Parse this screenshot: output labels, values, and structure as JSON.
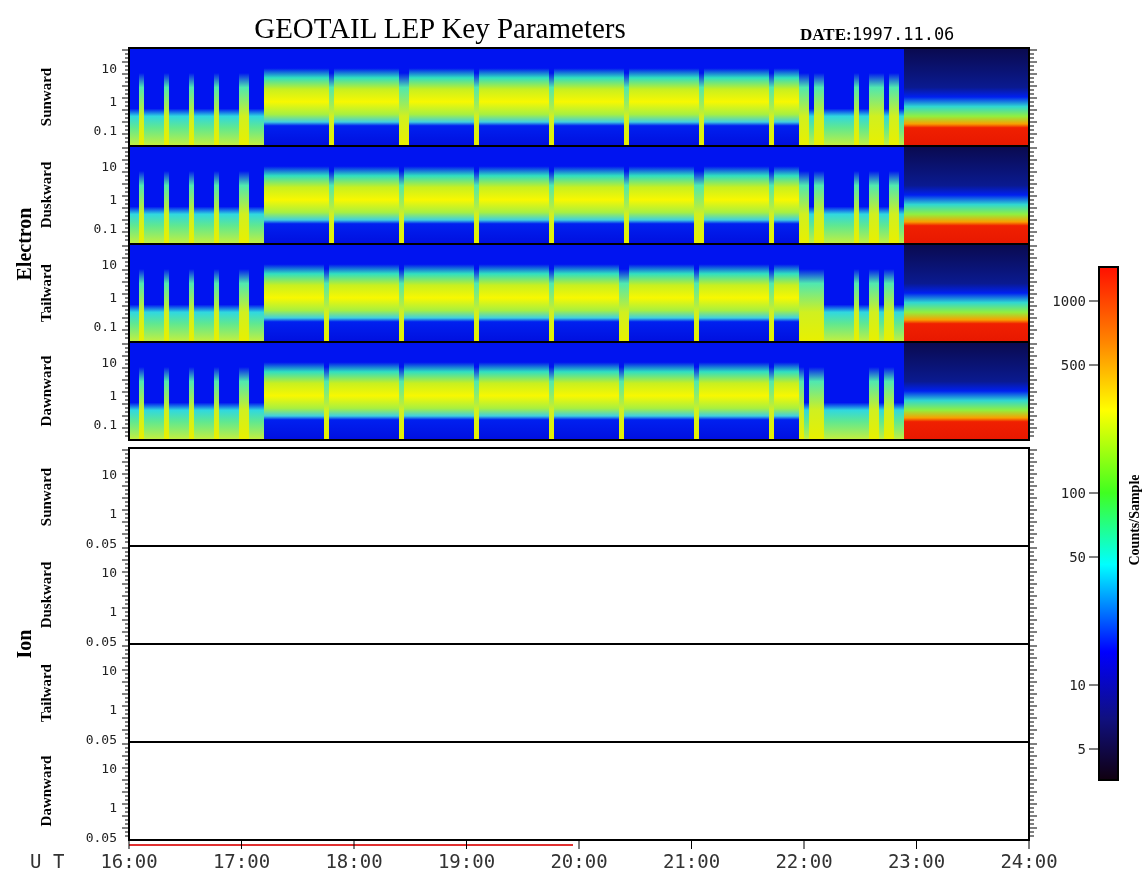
{
  "title": "GEOTAIL LEP Key Parameters",
  "date": {
    "label": "DATE:",
    "value": "1997.11.06"
  },
  "groups": [
    {
      "label": "Electron",
      "kind": "spectrogram",
      "panels": [
        {
          "label": "Sunward",
          "yticks": [
            "10",
            "1",
            "0.1"
          ]
        },
        {
          "label": "Duskward",
          "yticks": [
            "10",
            "1",
            "0.1"
          ]
        },
        {
          "label": "Tailward",
          "yticks": [
            "10",
            "1",
            "0.1"
          ]
        },
        {
          "label": "Dawnward",
          "yticks": [
            "10",
            "1",
            "0.1"
          ]
        }
      ]
    },
    {
      "label": "Ion",
      "kind": "empty",
      "panels": [
        {
          "label": "Sunward",
          "yticks": [
            "10",
            "1",
            "0.05"
          ]
        },
        {
          "label": "Duskward",
          "yticks": [
            "10",
            "1",
            "0.05"
          ]
        },
        {
          "label": "Tailward",
          "yticks": [
            "10",
            "1",
            "0.05"
          ]
        },
        {
          "label": "Dawnward",
          "yticks": [
            "10",
            "1",
            "0.05"
          ]
        }
      ]
    }
  ],
  "colorbar": {
    "label": "Counts/Sample",
    "ticks": [
      "1000",
      "500",
      "100",
      "50",
      "10",
      "5"
    ]
  },
  "x_axis": {
    "label": "U T",
    "ticks": [
      "16:00",
      "17:00",
      "18:00",
      "19:00",
      "20:00",
      "21:00",
      "22:00",
      "23:00",
      "24:00"
    ]
  }
}
